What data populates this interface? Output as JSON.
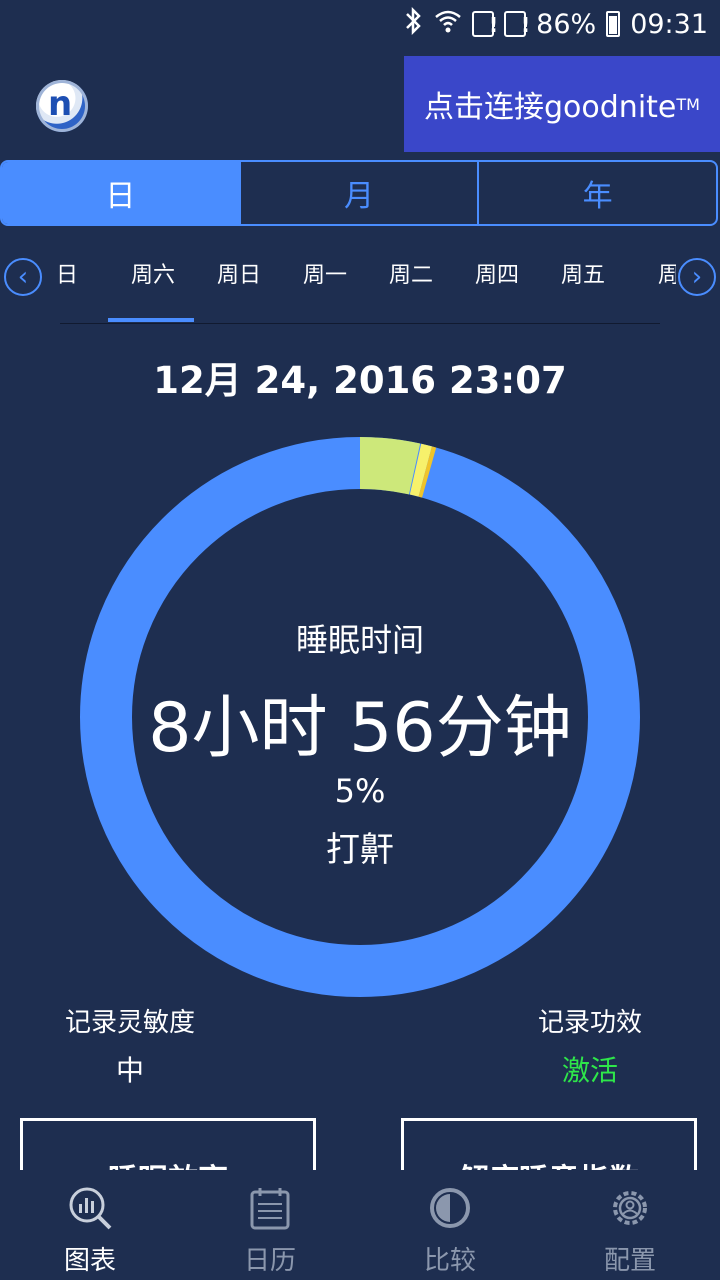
{
  "status_bar": {
    "battery": "86%",
    "time": "09:31"
  },
  "header": {
    "connect_label": "点击连接goodnite",
    "tm": "TM"
  },
  "segments": [
    "日",
    "月",
    "年"
  ],
  "days": [
    "日",
    "周六",
    "周日",
    "周一",
    "周二",
    "周四",
    "周五",
    "周"
  ],
  "datetime": "12月 24, 2016 23:07",
  "sleep": {
    "title": "睡眠时间",
    "duration": "8小时 56分钟",
    "percent": "5%",
    "label": "打鼾",
    "colors": {
      "main": "#4a8dff",
      "light_green": "#cde87a",
      "yellow": "#f7f16b",
      "orange": "#f0c42a"
    }
  },
  "settings": {
    "sensitivity_label": "记录灵敏度",
    "sensitivity_value": "中",
    "efficacy_label": "记录功效",
    "efficacy_value": "激活"
  },
  "cards": {
    "left": "睡眠效率",
    "right": "解度睡意指数"
  },
  "nav": [
    {
      "label": "图表",
      "icon": "chart-icon"
    },
    {
      "label": "日历",
      "icon": "calendar-icon"
    },
    {
      "label": "比较",
      "icon": "compare-icon"
    },
    {
      "label": "配置",
      "icon": "settings-icon"
    }
  ]
}
